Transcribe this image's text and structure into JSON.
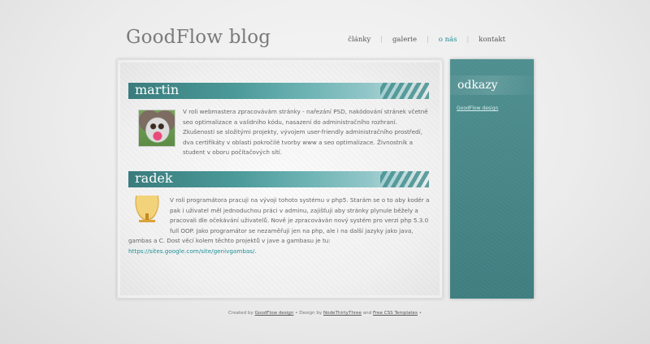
{
  "header": {
    "title": "GoodFlow blog",
    "nav": [
      {
        "label": "články",
        "active": false
      },
      {
        "label": "galerie",
        "active": false
      },
      {
        "label": "o nás",
        "active": true
      },
      {
        "label": "kontakt",
        "active": false
      }
    ],
    "separator": "|"
  },
  "posts": [
    {
      "title": "martin",
      "avatar": "dog-photo",
      "text": "V roli webmastera zpracovávám stránky - nařezání PSD, nakódování stránek včetně seo optimalizace a validního kódu, nasazení do administračního rozhraní. Zkušenosti se složitými projekty, vývojem user-friendly administračního prostředí, dva certifikáty v oblasti pokročilé tvorby www a seo optimalizace. Živnostník a student v oboru počítačových sítí."
    },
    {
      "title": "radek",
      "avatar": "trophy-cup-icon",
      "text": "V roli programátora pracuji na vývoji tohoto systému v php5. Starám se o to aby kodér a pak i uživatel měl jednoduchou práci v adminu, zajišťuji aby stránky plynule běžely a pracovali dle očekávání uživatelů. Nově je zpracováván nový systém pro verzi php 5.3.0 full OOP. Jako programátor se nezaměřuji jen na php, ale i na další jazyky jako java, gambas a C. Dost věcí kolem těchto projektů v jave a gambasu je tu: ",
      "link": "https://sites.google.com/site/genivgambas/",
      "after_link": "."
    }
  ],
  "sidebar": {
    "title": "odkazy",
    "links": [
      "GoodFlow design"
    ]
  },
  "footer": {
    "prefix": "Created by ",
    "link1": "GoodFlow design",
    "mid1": " • Design by ",
    "link2": "NodeThirtyThree",
    "mid2": " and ",
    "link3": "Free CSS Templates",
    "suffix": " •"
  },
  "colors": {
    "accent": "#1f8f95",
    "sidebar_bg": "#4a8a8b",
    "title_gray": "#7a7a7a"
  }
}
